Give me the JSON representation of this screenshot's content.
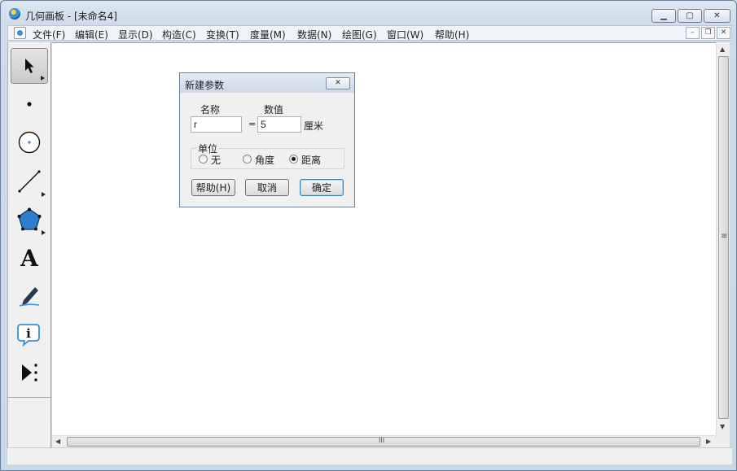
{
  "window": {
    "title": "几何画板 - [未命名4]",
    "controls": {
      "minimize": "▁",
      "maximize": "▢",
      "close": "✕"
    }
  },
  "menubar": {
    "items": [
      {
        "label": "文件(F)"
      },
      {
        "label": "编辑(E)"
      },
      {
        "label": "显示(D)"
      },
      {
        "label": "构造(C)"
      },
      {
        "label": "变换(T)"
      },
      {
        "label": "度量(M)"
      },
      {
        "label": "数据(N)"
      },
      {
        "label": "绘图(G)"
      },
      {
        "label": "窗口(W)"
      },
      {
        "label": "帮助(H)"
      }
    ],
    "mdi_controls": {
      "minimize": "–",
      "restore": "❐",
      "close": "✕"
    }
  },
  "toolbox": {
    "tools": [
      {
        "name": "arrow-select-icon",
        "active": true
      },
      {
        "name": "point-icon"
      },
      {
        "name": "compass-circle-icon"
      },
      {
        "name": "straightedge-segment-icon"
      },
      {
        "name": "polygon-icon"
      },
      {
        "name": "text-icon",
        "glyph": "A"
      },
      {
        "name": "marker-pen-icon"
      },
      {
        "name": "information-icon",
        "glyph": "i"
      },
      {
        "name": "custom-tool-icon"
      }
    ]
  },
  "scrollbars": {
    "v_up": "▲",
    "v_down": "▼",
    "v_grip": "≡",
    "h_left": "◀",
    "h_right": "▶",
    "h_grip": "III"
  },
  "dialog": {
    "title": "新建参数",
    "close_glyph": "✕",
    "name_label": "名称",
    "value_label": "数值",
    "name_value": "r",
    "equals": "=",
    "number_value": "5",
    "unit_suffix": "厘米",
    "unit_group_label": "单位",
    "units": [
      {
        "label": "无",
        "selected": false
      },
      {
        "label": "角度",
        "selected": false
      },
      {
        "label": "距离",
        "selected": true
      }
    ],
    "buttons": {
      "help": "帮助(H)",
      "cancel": "取消",
      "ok": "确定"
    }
  }
}
